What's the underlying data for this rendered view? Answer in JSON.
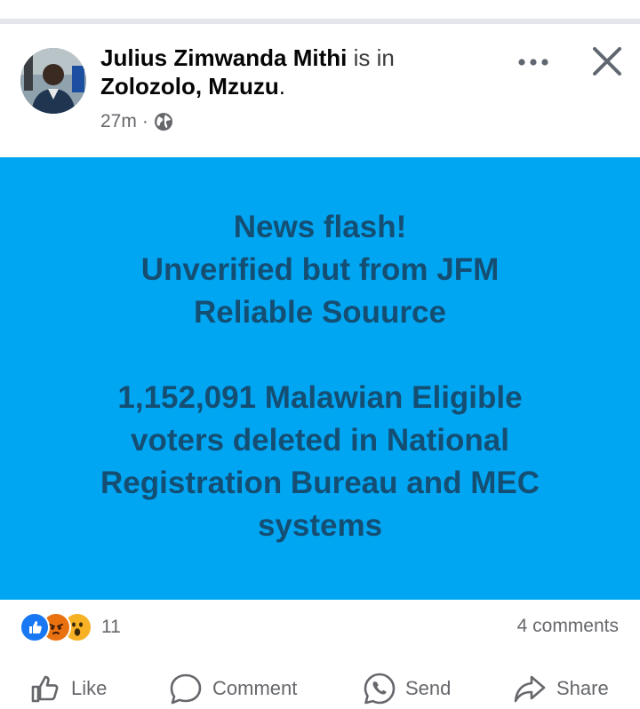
{
  "post": {
    "author": "Julius Zimwanda Mithi",
    "connector": "is in",
    "location": "Zolozolo, Mzuzu",
    "location_suffix": ".",
    "time": "27m",
    "separator": "·",
    "audience_icon": "globe-icon",
    "text": "News flash!\nUnverified but from JFM\nReliable Souurce\n\n1,152,091 Malawian Eligible\nvoters deleted in National\nRegistration Bureau and MEC\nsystems",
    "card_color": "#00a6f2",
    "text_color": "#154e73"
  },
  "header_icons": [
    "more-icon",
    "close-icon"
  ],
  "engagement": {
    "reactions": [
      "like-reaction-icon",
      "angry-reaction-icon",
      "wow-reaction-icon"
    ],
    "reaction_count": "11",
    "comments": "4 comments"
  },
  "actions": {
    "like": "Like",
    "comment": "Comment",
    "send": "Send",
    "share": "Share"
  }
}
